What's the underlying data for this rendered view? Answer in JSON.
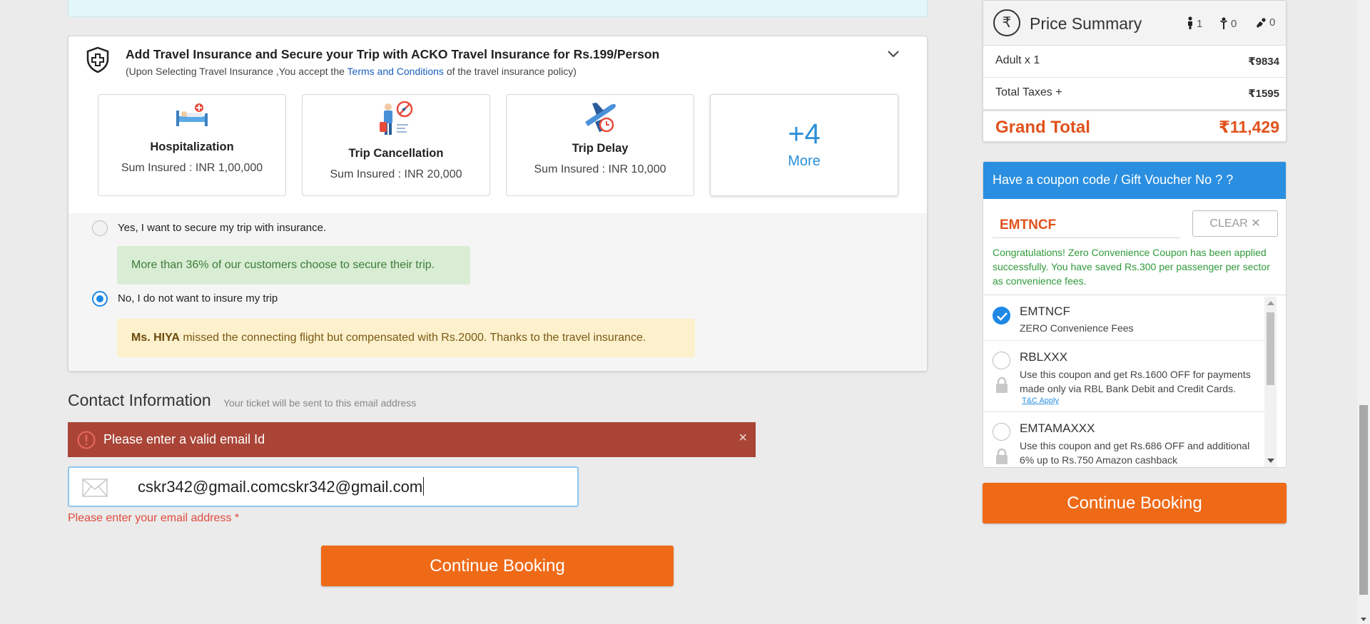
{
  "insurance": {
    "title": "Add Travel Insurance and Secure your Trip with ACKO Travel Insurance for Rs.199/Person",
    "subtitle_before": "(Upon Selecting Travel Insurance ,You accept the ",
    "subtitle_link": "Terms and Conditions",
    "subtitle_after": " of the travel insurance policy)",
    "benefits": [
      {
        "title": "Hospitalization",
        "sum": "Sum Insured : INR 1,00,000",
        "icon": "hospital-bed-icon"
      },
      {
        "title": "Trip Cancellation",
        "sum": "Sum Insured : INR 20,000",
        "icon": "trip-cancellation-icon"
      },
      {
        "title": "Trip Delay",
        "sum": "Sum Insured : INR 10,000",
        "icon": "flight-delay-icon"
      }
    ],
    "more": {
      "count": "+4",
      "label": "More"
    },
    "options": {
      "yes_label": "Yes, I want to secure my trip with insurance.",
      "yes_note": "More than 36% of our customers choose to secure their trip.",
      "no_label": "No, I do not want to insure my trip",
      "no_note_name": "Ms. HIYA",
      "no_note_text": " missed the connecting flight but compensated with Rs.2000. Thanks to the travel insurance.",
      "selected": "no"
    }
  },
  "contact": {
    "title": "Contact Information",
    "subtitle": "Your ticket will be sent to this email address",
    "error_banner": "Please enter a valid email Id",
    "error_close": "×",
    "email_value": "cskr342@gmail.comcskr342@gmail.com",
    "email_error": "Please enter your email address *"
  },
  "continue_label": "Continue Booking",
  "price_summary": {
    "currency_symbol": "₹",
    "title": "Price Summary",
    "adults": "1",
    "children": "0",
    "infants": "0",
    "rows": [
      {
        "label": "Adult x 1",
        "value": "9834"
      },
      {
        "label": "Total Taxes +",
        "value": "1595"
      }
    ],
    "grand_total_label": "Grand Total",
    "grand_total_value": "11,429"
  },
  "coupon": {
    "header": "Have a coupon code / Gift Voucher No ? ?",
    "code_value": "EMTNCF",
    "clear_label": "CLEAR",
    "clear_icon": "✕",
    "success_message": "Congratulations! Zero Convenience Coupon has been applied successfully. You have saved Rs.300 per passenger per sector as convenience fees.",
    "items": [
      {
        "code": "EMTNCF",
        "desc": "ZERO Convenience Fees",
        "checked": true
      },
      {
        "code": "RBLXXX",
        "desc": "Use this coupon and get Rs.1600 OFF for payments made only via RBL Bank Debit and Credit Cards.",
        "tc": "T&C Apply",
        "locked": true
      },
      {
        "code": "EMTAMAXXX",
        "desc": "Use this coupon and get Rs.686 OFF and additional 6% up to Rs.750 Amazon cashback",
        "locked": true
      }
    ]
  },
  "colors": {
    "accent_orange": "#ef6a17",
    "accent_blue": "#2a8fe0",
    "error_red": "#a94436",
    "success_green": "#2f9a3a"
  }
}
